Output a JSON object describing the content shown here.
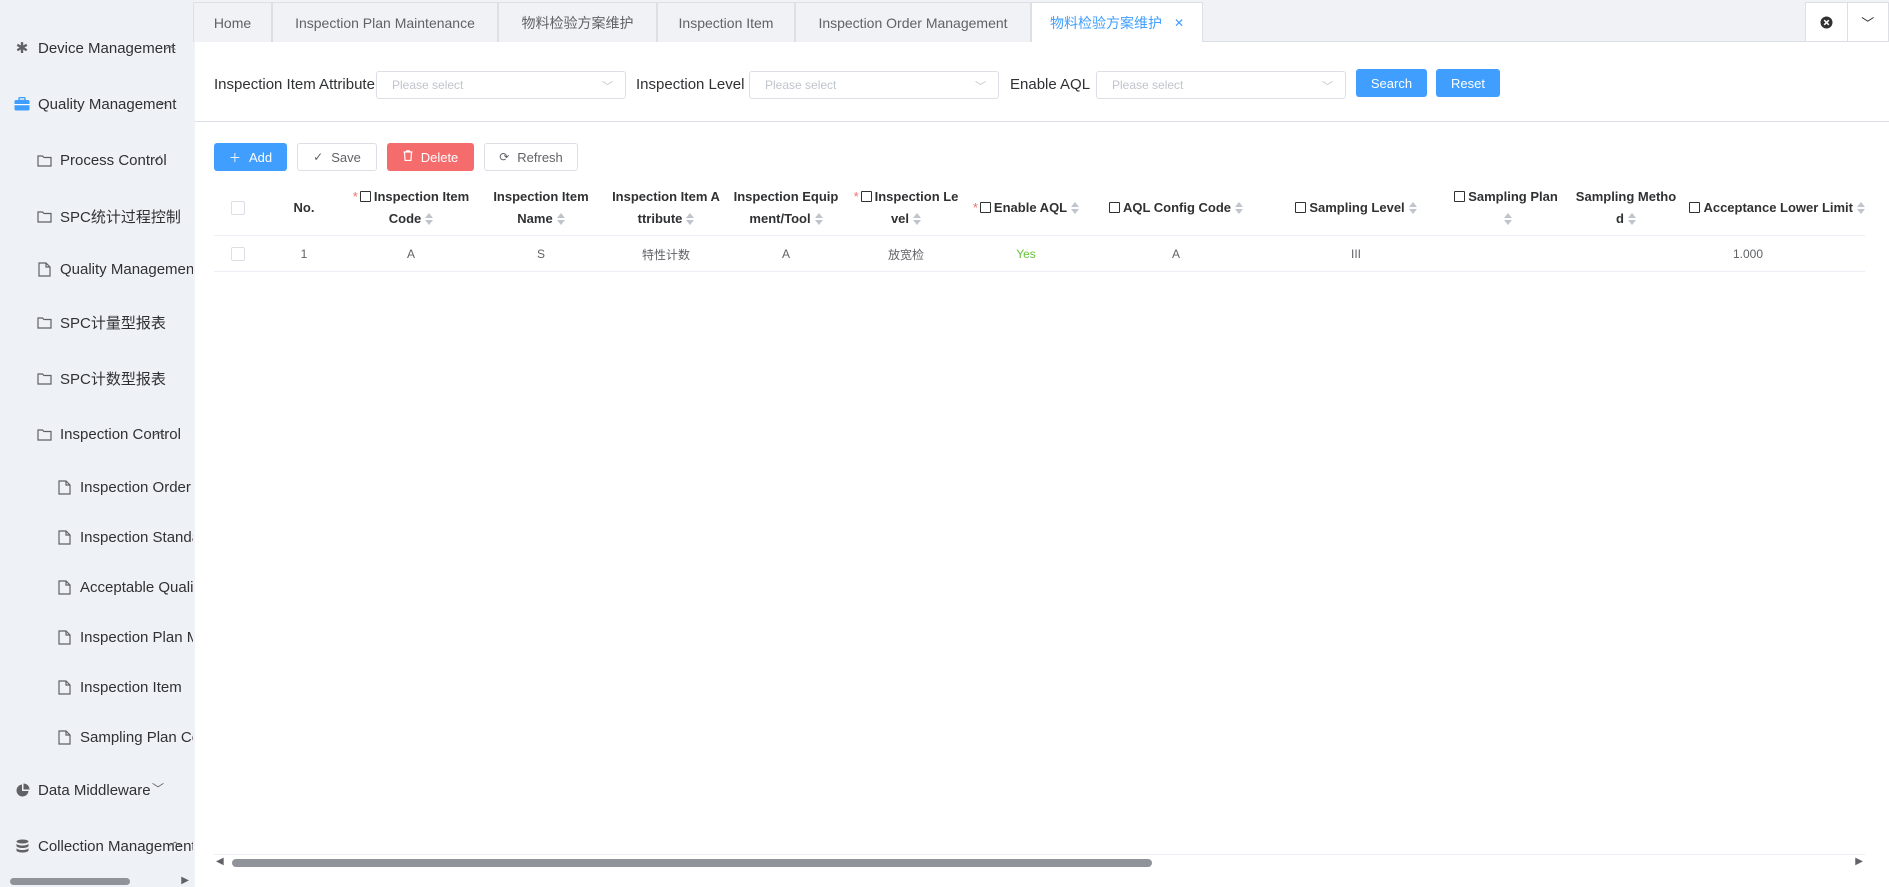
{
  "sidebar": {
    "items": [
      {
        "label": "Device Management",
        "icon": "asterisk-icon"
      },
      {
        "label": "Quality Management",
        "icon": "briefcase-icon"
      },
      {
        "label": "Process Control",
        "icon": "folder-icon"
      },
      {
        "label": "SPC统计过程控制",
        "icon": "folder-icon"
      },
      {
        "label": "Quality Management R",
        "icon": "file-icon"
      },
      {
        "label": "SPC计量型报表",
        "icon": "folder-icon"
      },
      {
        "label": "SPC计数型报表",
        "icon": "folder-icon"
      },
      {
        "label": "Inspection Control",
        "icon": "folder-icon"
      },
      {
        "label": "Inspection Order M",
        "icon": "file-icon"
      },
      {
        "label": "Inspection Standard",
        "icon": "file-icon"
      },
      {
        "label": "Acceptable Quality",
        "icon": "file-icon"
      },
      {
        "label": "Inspection Plan Ma",
        "icon": "file-icon"
      },
      {
        "label": "Inspection Item",
        "icon": "file-icon"
      },
      {
        "label": "Sampling Plan Con",
        "icon": "file-icon"
      },
      {
        "label": "Data Middleware",
        "icon": "pie-chart-icon"
      },
      {
        "label": "Collection Management",
        "icon": "database-icon"
      }
    ]
  },
  "tabs": [
    {
      "label": "Home"
    },
    {
      "label": "Inspection Plan Maintenance"
    },
    {
      "label": "物料检验方案维护"
    },
    {
      "label": "Inspection Item"
    },
    {
      "label": "Inspection Order Management"
    },
    {
      "label": "物料检验方案维护",
      "active": true
    }
  ],
  "filters": {
    "attribute_label": "Inspection Item Attribute",
    "attribute_placeholder": "Please select",
    "level_label": "Inspection Level",
    "level_placeholder": "Please select",
    "aql_label": "Enable AQL",
    "aql_placeholder": "Please select",
    "search_label": "Search",
    "reset_label": "Reset"
  },
  "toolbar": {
    "add_label": "Add",
    "save_label": "Save",
    "delete_label": "Delete",
    "refresh_label": "Refresh"
  },
  "table": {
    "columns": [
      {
        "label": "No."
      },
      {
        "label1": "Inspection Item",
        "label2": "Code"
      },
      {
        "label1": "Inspection Item",
        "label2": "Name"
      },
      {
        "label1": "Inspection Item A",
        "label2": "ttribute"
      },
      {
        "label1": "Inspection Equip",
        "label2": "ment/Tool"
      },
      {
        "label1": "Inspection Le",
        "label2": "vel"
      },
      {
        "label": "Enable AQL"
      },
      {
        "label": "AQL Config Code"
      },
      {
        "label": "Sampling Level"
      },
      {
        "label1": "Sampling Plan",
        "label2": ""
      },
      {
        "label1": "Sampling Metho",
        "label2": "d"
      },
      {
        "label": "Acceptance Lower Limit"
      }
    ],
    "rows": [
      {
        "no": "1",
        "code": "A",
        "name": "S",
        "attribute": "特性计数",
        "equipment": "A",
        "level": "放宽检",
        "aql": "Yes",
        "aql_code": "A",
        "sampling_level": "III",
        "sampling_plan": "",
        "sampling_method": "",
        "lower_limit": "1.000"
      }
    ]
  },
  "colors": {
    "primary": "#409eff",
    "danger": "#f56c6c",
    "success": "#67c23a"
  }
}
